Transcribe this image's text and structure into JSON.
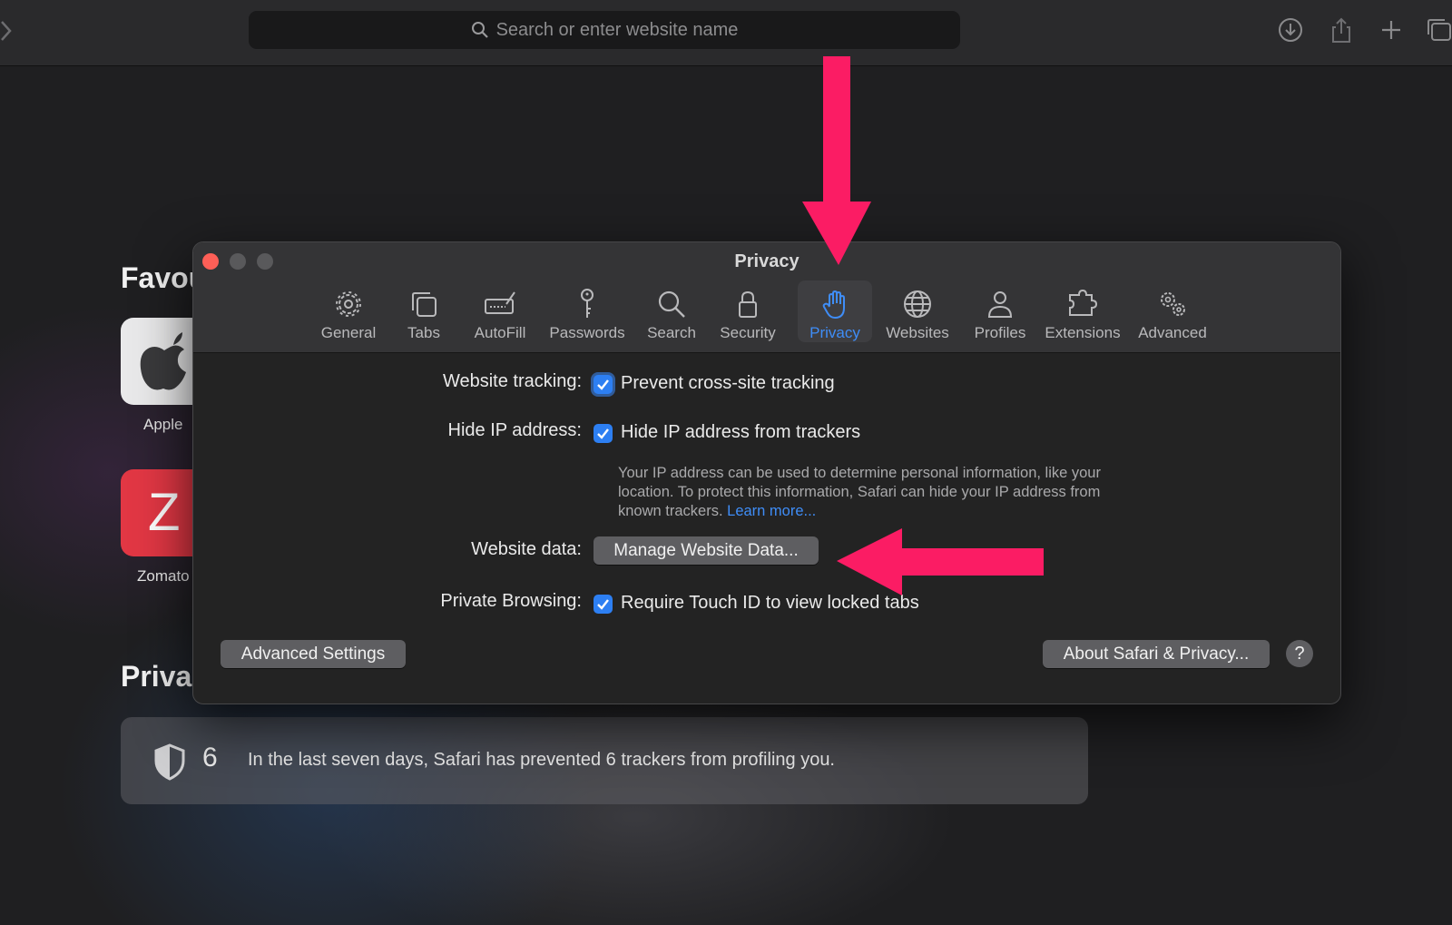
{
  "toolbar": {
    "address_placeholder": "Search or enter website name",
    "icons": [
      "chevron-right-icon",
      "search-icon",
      "download-icon",
      "share-icon",
      "plus-icon",
      "tabs-overview-icon"
    ]
  },
  "start_page": {
    "favourites_heading": "Favou",
    "favourites": [
      {
        "label": "Apple",
        "icon": "apple-logo-icon",
        "tile_color": "#e9e9ea"
      },
      {
        "label": "Zomato",
        "letter": "Z",
        "tile_color": "#e23744"
      }
    ],
    "privacy_heading": "Priva",
    "privacy_report": {
      "count": "6",
      "text": "In the last seven days, Safari has prevented 6 trackers from profiling you."
    }
  },
  "preferences": {
    "title": "Privacy",
    "tabs": [
      {
        "label": "General",
        "icon": "gear-icon"
      },
      {
        "label": "Tabs",
        "icon": "tabs-icon"
      },
      {
        "label": "AutoFill",
        "icon": "autofill-icon"
      },
      {
        "label": "Passwords",
        "icon": "key-icon"
      },
      {
        "label": "Search",
        "icon": "search-icon"
      },
      {
        "label": "Security",
        "icon": "lock-icon"
      },
      {
        "label": "Privacy",
        "icon": "hand-icon",
        "active": true
      },
      {
        "label": "Websites",
        "icon": "globe-icon"
      },
      {
        "label": "Profiles",
        "icon": "person-icon"
      },
      {
        "label": "Extensions",
        "icon": "puzzle-icon"
      },
      {
        "label": "Advanced",
        "icon": "gears-icon"
      }
    ],
    "website_tracking": {
      "label": "Website tracking:",
      "option": "Prevent cross-site tracking",
      "checked": true
    },
    "hide_ip": {
      "label": "Hide IP address:",
      "option": "Hide IP address from trackers",
      "checked": true,
      "note": "Your IP address can be used to determine personal information, like your location. To protect this information, Safari can hide your IP address from known trackers.",
      "link": "Learn more..."
    },
    "website_data": {
      "label": "Website data:",
      "button": "Manage Website Data..."
    },
    "private_browsing": {
      "label": "Private Browsing:",
      "option": "Require Touch ID to view locked tabs",
      "checked": true
    },
    "advanced_settings_button": "Advanced Settings",
    "about_button": "About Safari & Privacy...",
    "help_button": "?"
  },
  "annotation_color": "#fb1c64"
}
